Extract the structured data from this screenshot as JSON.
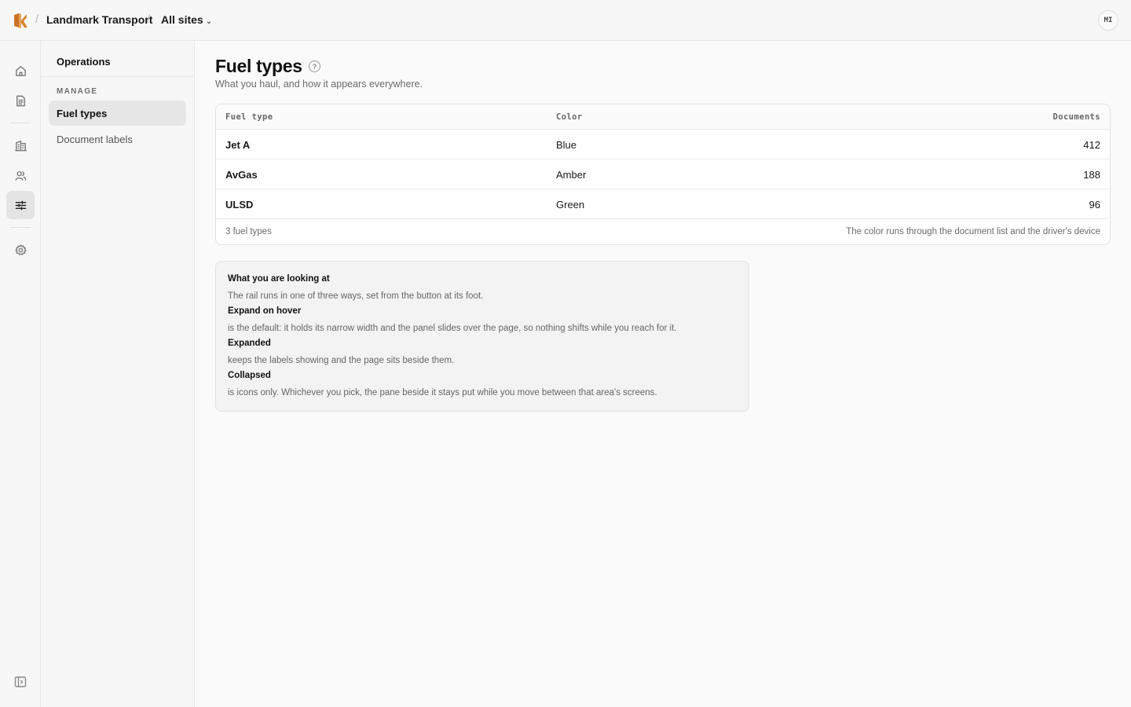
{
  "breadcrumb": {
    "org": "Landmark Transport",
    "scope": "All sites"
  },
  "user": {
    "initials": "MI"
  },
  "rail": {
    "items": [
      {
        "name": "home-icon"
      },
      {
        "name": "document-icon"
      },
      {
        "name": "building-icon"
      },
      {
        "name": "users-icon"
      },
      {
        "name": "sliders-icon",
        "active": true
      },
      {
        "name": "gear-icon"
      }
    ],
    "collapse": "panel-toggle-icon"
  },
  "subnav": {
    "title": "Operations",
    "section": "MANAGE",
    "items": [
      {
        "label": "Fuel types",
        "active": true
      },
      {
        "label": "Document labels"
      }
    ]
  },
  "page": {
    "title": "Fuel types",
    "subtitle": "What you haul, and how it appears everywhere."
  },
  "table": {
    "columns": [
      "Fuel type",
      "Color",
      "Documents"
    ],
    "rows": [
      {
        "fuel": "Jet A",
        "color": "Blue",
        "documents": "412"
      },
      {
        "fuel": "AvGas",
        "color": "Amber",
        "documents": "188"
      },
      {
        "fuel": "ULSD",
        "color": "Green",
        "documents": "96"
      }
    ],
    "footer_count": "3 fuel types",
    "footer_note": "The color runs through the document list and the driver's device"
  },
  "info": {
    "heading": "What you are looking at",
    "intro": "The rail runs in one of three ways, set from the button at its foot.",
    "modes": [
      {
        "title": "Expand on hover",
        "desc": "is the default: it holds its narrow width and the panel slides over the page, so nothing shifts while you reach for it."
      },
      {
        "title": "Expanded",
        "desc": "keeps the labels showing and the page sits beside them."
      },
      {
        "title": "Collapsed",
        "desc": "is icons only. Whichever you pick, the pane beside it stays put while you move between that area's screens."
      }
    ]
  },
  "colors": {
    "accent_logo": "#d9822b",
    "active_bg": "#e4e4e4"
  }
}
